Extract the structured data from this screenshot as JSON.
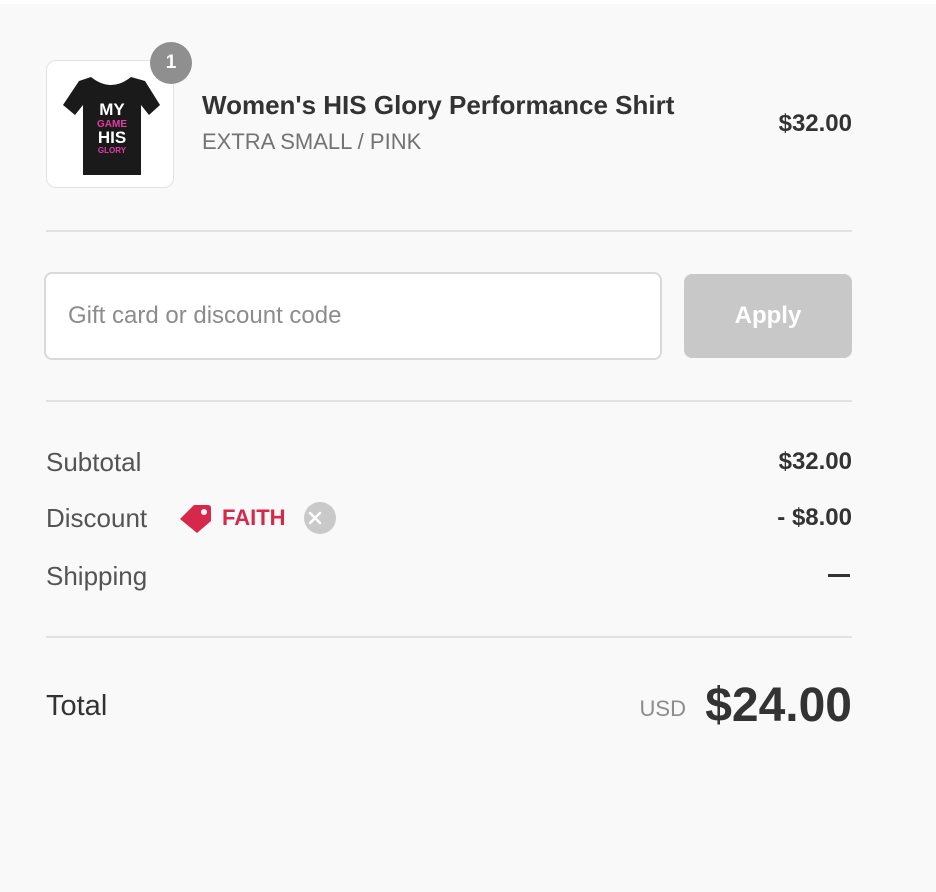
{
  "product": {
    "quantity": "1",
    "name": "Women's HIS Glory Performance Shirt",
    "variant": "EXTRA SMALL / PINK",
    "price": "$32.00",
    "image_icon": "tshirt-icon",
    "image_text": [
      "MY",
      "GAME",
      "HIS",
      "GLORY"
    ]
  },
  "discount_form": {
    "placeholder": "Gift card or discount code",
    "value": "",
    "apply_label": "Apply"
  },
  "summary": {
    "subtotal_label": "Subtotal",
    "subtotal_value": "$32.00",
    "discount_label": "Discount",
    "discount_code": "FAITH",
    "discount_value": "- $8.00",
    "shipping_label": "Shipping",
    "shipping_value": "—"
  },
  "total": {
    "label": "Total",
    "currency": "USD",
    "value": "$24.00"
  },
  "colors": {
    "accent_discount": "#d7284b",
    "apply_disabled": "#c8c8c8",
    "badge": "#8f8f8f"
  }
}
